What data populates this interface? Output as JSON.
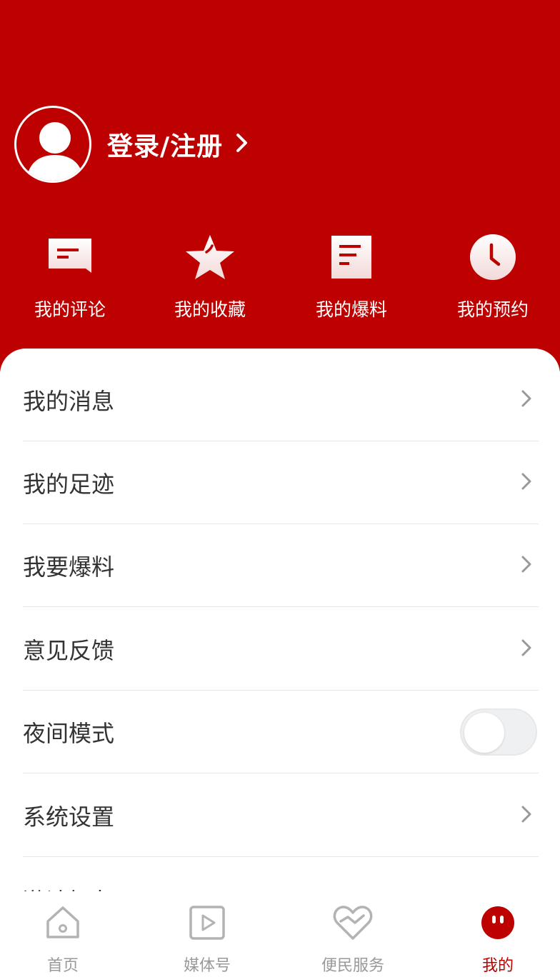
{
  "theme": {
    "primary": "#bd0000",
    "text": "#333333",
    "muted": "#999999"
  },
  "profile": {
    "login_label": "登录/注册",
    "avatar_icon": "user-avatar-icon",
    "arrow_icon": "chevron-right-icon"
  },
  "quick_actions": [
    {
      "label": "我的评论",
      "icon": "comment-icon"
    },
    {
      "label": "我的收藏",
      "icon": "star-icon"
    },
    {
      "label": "我的爆料",
      "icon": "document-icon"
    },
    {
      "label": "我的预约",
      "icon": "clock-icon"
    }
  ],
  "menu": [
    {
      "label": "我的消息",
      "type": "link"
    },
    {
      "label": "我的足迹",
      "type": "link"
    },
    {
      "label": "我要爆料",
      "type": "link"
    },
    {
      "label": "意见反馈",
      "type": "link"
    },
    {
      "label": "夜间模式",
      "type": "toggle",
      "enabled": false
    },
    {
      "label": "系统设置",
      "type": "link"
    }
  ],
  "partial_menu_item": "激请好友",
  "tabs": [
    {
      "label": "首页",
      "icon": "home-icon",
      "active": false
    },
    {
      "label": "媒体号",
      "icon": "video-play-icon",
      "active": false
    },
    {
      "label": "便民服务",
      "icon": "heart-service-icon",
      "active": false
    },
    {
      "label": "我的",
      "icon": "mine-face-icon",
      "active": true
    }
  ]
}
